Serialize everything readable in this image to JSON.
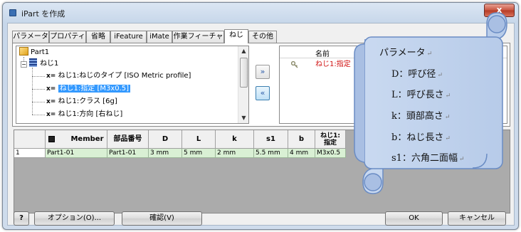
{
  "window": {
    "title": "iPart を作成",
    "close_label": "x"
  },
  "tabs": [
    "パラメータ",
    "プロパティ",
    "省略",
    "iFeature",
    "iMate",
    "作業フィーチャ",
    "ねじ",
    "その他"
  ],
  "active_tab": "ねじ",
  "tree": {
    "root": "Part1",
    "group": "ねじ1",
    "items": [
      {
        "prefix": "x=",
        "label": "ねじ1:ねじのタイプ [ISO Metric profile]"
      },
      {
        "prefix": "x=",
        "label": "ねじ1:指定 [M3x0.5]",
        "selected": true
      },
      {
        "prefix": "x=",
        "label": "ねじ1:クラス [6g]"
      },
      {
        "prefix": "x=",
        "label": "ねじ1:方向 [右ねじ]"
      }
    ]
  },
  "move_buttons": {
    "add": "»",
    "remove": "«"
  },
  "selected_list": {
    "header": "名前",
    "rows": [
      {
        "name": "ねじ1:指定"
      }
    ]
  },
  "table": {
    "headers": [
      "Member",
      "部品番号",
      "D",
      "L",
      "k",
      "s1",
      "b",
      "ねじ1:\n指定"
    ],
    "rows": [
      {
        "num": "1",
        "cells": [
          "Part1-01",
          "Part1-01",
          "3 mm",
          "5 mm",
          "2 mm",
          "5.5 mm",
          "4 mm",
          "M3x0.5"
        ]
      }
    ]
  },
  "buttons": {
    "help": "?",
    "options": "オプション(O)...",
    "verify": "確認(V)",
    "ok": "OK",
    "cancel": "キャンセル"
  },
  "callout": {
    "lines": [
      "パラメータ",
      "D：呼び径",
      "L：呼び長さ",
      "k：頭部高さ",
      "b：ねじ長さ",
      "s1：六角二面幅"
    ],
    "mark": "↵"
  }
}
